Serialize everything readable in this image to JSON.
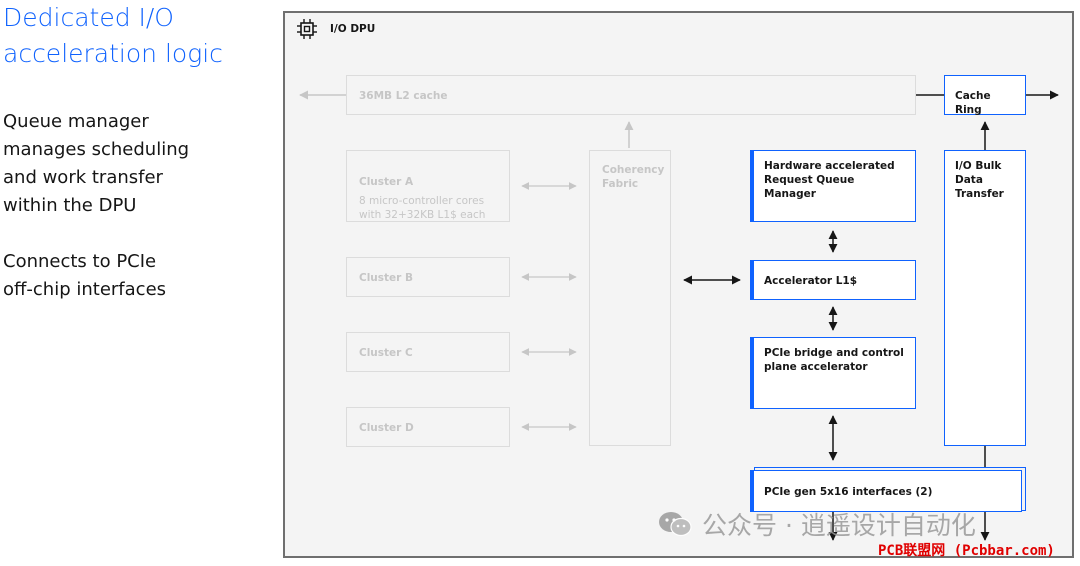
{
  "slide": {
    "title": "Dedicated I/O\nacceleration logic",
    "paragraphs": [
      "Queue manager\nmanages scheduling\nand work transfer\nwithin the DPU",
      "Connects to PCIe\noff-chip interfaces"
    ]
  },
  "diagram": {
    "header": "I/O DPU",
    "header_icon": "chip-icon",
    "l2_cache": "36MB L2 cache",
    "clusters": [
      {
        "name": "Cluster A",
        "detail": "8 micro-controller cores\nwith 32+32KB L1$ each"
      },
      {
        "name": "Cluster B",
        "detail": ""
      },
      {
        "name": "Cluster C",
        "detail": ""
      },
      {
        "name": "Cluster D",
        "detail": ""
      }
    ],
    "coherency_fabric": "Coherency\nFabric",
    "queue_manager": "Hardware accelerated\nRequest Queue Manager",
    "accelerator_l1": "Accelerator L1$",
    "pcie_bridge": "PCIe bridge and control\nplane accelerator",
    "cache_ring": "Cache Ring",
    "bulk_transfer": "I/O Bulk\nData\nTransfer",
    "pcie_interfaces": "PCIe gen 5x16 interfaces (2)",
    "active_color": "#0f62fe",
    "dim_color": "#c6c6c6"
  },
  "watermark": {
    "text": "公众号 · 逍遥设计自动化",
    "icon": "wechat-icon",
    "credit": "PCB联盟网 (Pcbbar.com)"
  }
}
